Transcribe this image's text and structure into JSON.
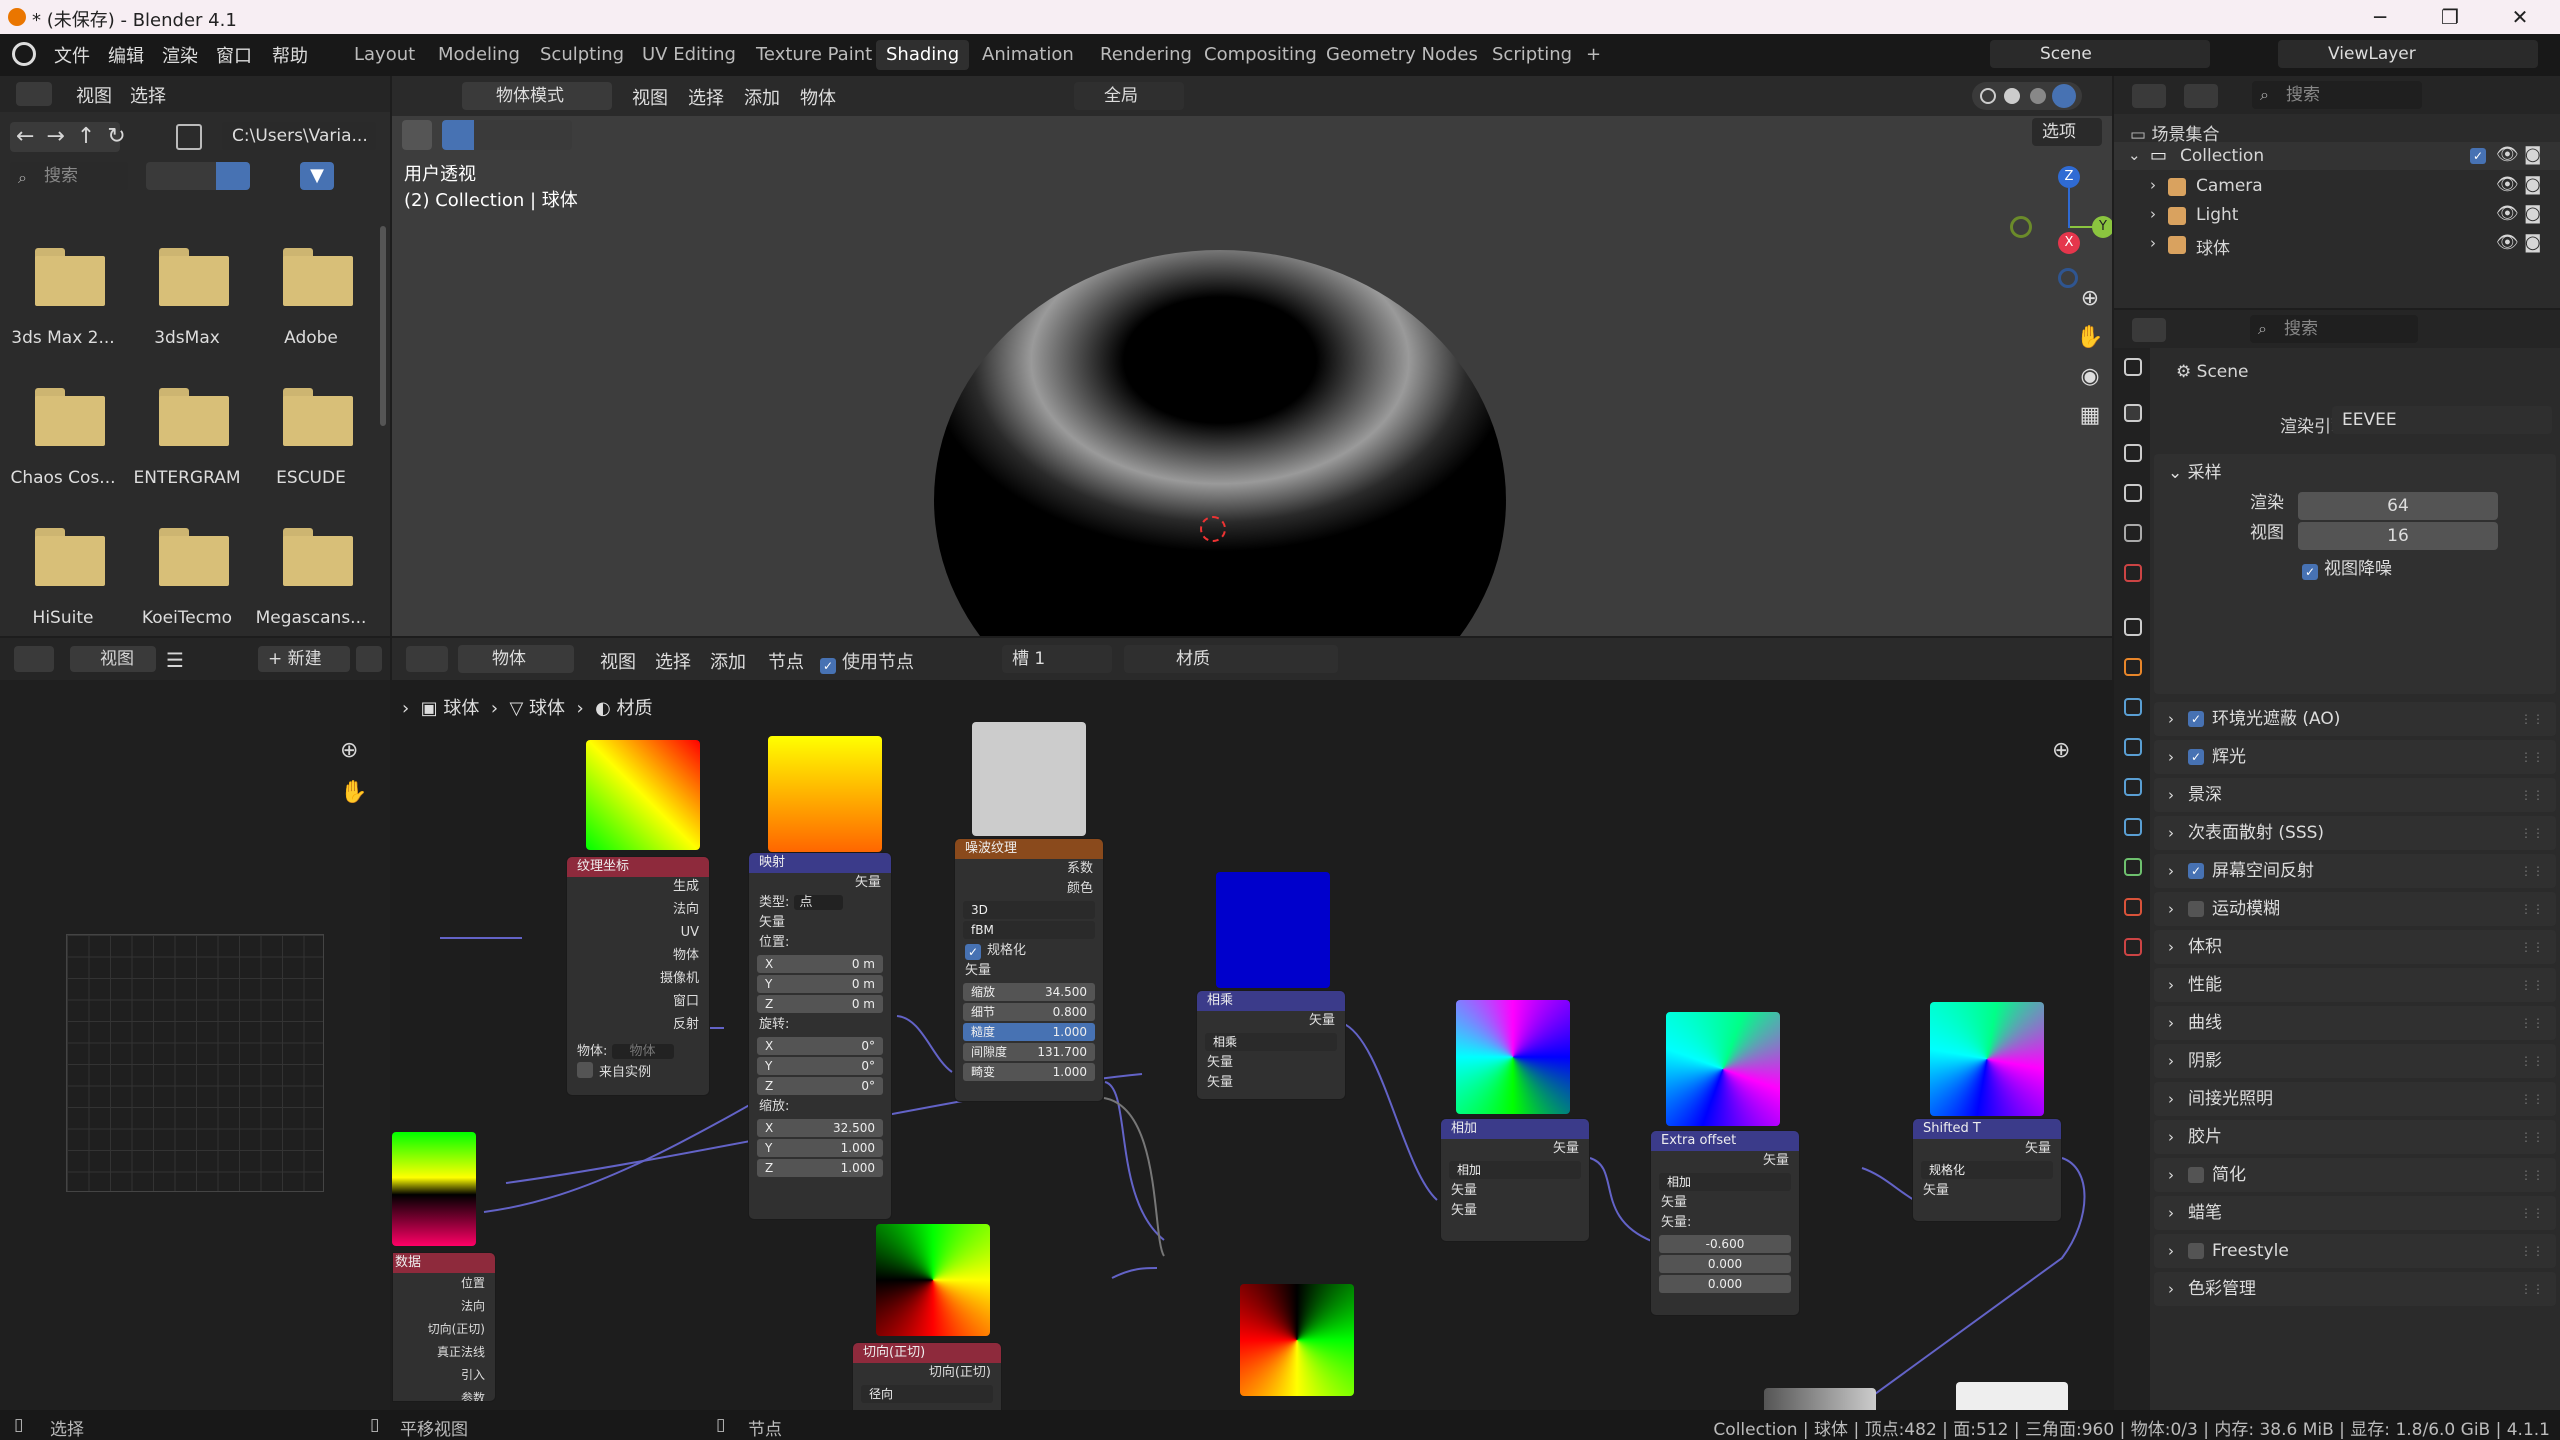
{
  "window": {
    "title": "* (未保存) - Blender 4.1",
    "minimize": "─",
    "maximize": "❐",
    "close": "✕"
  },
  "menus": [
    "文件",
    "编辑",
    "渲染",
    "窗口",
    "帮助"
  ],
  "workspaces": [
    "Layout",
    "Modeling",
    "Sculpting",
    "UV Editing",
    "Texture Paint",
    "Shading",
    "Animation",
    "Rendering",
    "Compositing",
    "Geometry Nodes",
    "Scripting",
    "+"
  ],
  "scene": {
    "label": "Scene",
    "viewlayer": "ViewLayer"
  },
  "filebrowser": {
    "menu": [
      "视图",
      "选择"
    ],
    "path": "C:\\Users\\Varia...",
    "search_placeholder": "搜索",
    "folders": [
      "3ds Max 2...",
      "3dsMax",
      "Adobe",
      "Chaos Cos...",
      "ENTERGRAM",
      "ESCUDE",
      "HiSuite",
      "KoeiTecmo",
      "Megascans..."
    ]
  },
  "viewport": {
    "mode": "物体模式",
    "menu": [
      "视图",
      "选择",
      "添加",
      "物体"
    ],
    "transform": "全局",
    "options": "选项",
    "overlay_title": "用户透视",
    "overlay_sub": "(2) Collection | 球体",
    "axes": {
      "z": "Z",
      "y": "Y",
      "x": "X"
    }
  },
  "image_editor": {
    "menu": "视图",
    "new_label": "+ 新建"
  },
  "node_editor": {
    "type": "物体",
    "menu": [
      "视图",
      "选择",
      "添加",
      "节点"
    ],
    "use_nodes": "使用节点",
    "slot": "槽 1",
    "material": "材质",
    "breadcrumb": [
      "球体",
      "球体",
      "材质"
    ]
  },
  "nodes": {
    "texcoord": {
      "title": "纹理坐标",
      "outputs": [
        "生成",
        "法向",
        "UV",
        "物体",
        "摄像机",
        "窗口",
        "反射"
      ],
      "object_label": "物体:",
      "object_placeholder": "物体",
      "from_instancer": "来自实例"
    },
    "mapping": {
      "title": "映射",
      "out": "矢量",
      "type_label": "类型:",
      "type_value": "点",
      "vector": "矢量",
      "location": "位置:",
      "loc": [
        [
          "X",
          "0 m"
        ],
        [
          "Y",
          "0 m"
        ],
        [
          "Z",
          "0 m"
        ]
      ],
      "rotation": "旋转:",
      "rot": [
        [
          "X",
          "0°"
        ],
        [
          "Y",
          "0°"
        ],
        [
          "Z",
          "0°"
        ]
      ],
      "scale": "缩放:",
      "scl": [
        [
          "X",
          "32.500"
        ],
        [
          "Y",
          "1.000"
        ],
        [
          "Z",
          "1.000"
        ]
      ]
    },
    "noise": {
      "title": "噪波纹理",
      "out_fac": "系数",
      "out_color": "颜色",
      "dim": "3D",
      "type": "fBM",
      "normalize": "规格化",
      "vector": "矢量",
      "fields": [
        [
          "缩放",
          "34.500"
        ],
        [
          "细节",
          "0.800"
        ],
        [
          "糙度",
          "1.000"
        ],
        [
          "间隙度",
          "131.700"
        ],
        [
          "畸变",
          "1.000"
        ]
      ]
    },
    "mult1": {
      "title": "相乘",
      "out": "矢量",
      "op": "相乘",
      "in": [
        "矢量",
        "矢量"
      ]
    },
    "add1": {
      "title": "相加",
      "out": "矢量",
      "op": "相加",
      "in": [
        "矢量",
        "矢量"
      ]
    },
    "extra": {
      "title": "Extra offset",
      "out": "矢量",
      "op": "相加",
      "in": [
        "矢量",
        "矢量:"
      ],
      "vals": [
        "-0.600",
        "0.000",
        "0.000"
      ]
    },
    "shifted": {
      "title": "Shifted T",
      "out": "矢量",
      "op": "规格化",
      "in": [
        "矢量"
      ]
    },
    "geometry": {
      "title": "数据",
      "outputs": [
        "位置",
        "法向",
        "切向(正切)",
        "真正法线",
        "引入",
        "参数"
      ]
    },
    "tangent": {
      "title": "切向(正切)",
      "out": "切向(正切)",
      "field": "径向"
    }
  },
  "outliner": {
    "search_placeholder": "搜索",
    "root": "场景集合",
    "collection": "Collection",
    "items": [
      "Camera",
      "Light",
      "球体"
    ]
  },
  "properties": {
    "search_placeholder": "搜索",
    "scene": "Scene",
    "engine_label": "渲染引擎",
    "engine": "EEVEE",
    "sampling": "采样",
    "render_label": "渲染",
    "render_val": "64",
    "viewport_label": "视图",
    "viewport_val": "16",
    "denoise": "视图降噪",
    "sections": [
      [
        "环境光遮蔽 (AO)",
        true
      ],
      [
        "辉光",
        true
      ],
      [
        "景深",
        null
      ],
      [
        "次表面散射 (SSS)",
        null
      ],
      [
        "屏幕空间反射",
        true
      ],
      [
        "运动模糊",
        false
      ],
      [
        "体积",
        null
      ],
      [
        "性能",
        null
      ],
      [
        "曲线",
        null
      ],
      [
        "阴影",
        null
      ],
      [
        "间接光照明",
        null
      ],
      [
        "胶片",
        null
      ],
      [
        "简化",
        false
      ],
      [
        "蜡笔",
        null
      ],
      [
        "Freestyle",
        false
      ],
      [
        "色彩管理",
        null
      ]
    ]
  },
  "statusbar": {
    "select": "选择",
    "pan": "平移视图",
    "node": "节点",
    "info": "Collection | 球体 | 顶点:482 | 面:512 | 三角面:960 | 物体:0/3 | 内存: 38.6 MiB | 显存: 1.8/6.0 GiB | 4.1.1"
  },
  "colors": {
    "accent": "#4772b3",
    "header": "#252525",
    "panel": "#2b2b2b",
    "folder": "#d8bf78"
  }
}
